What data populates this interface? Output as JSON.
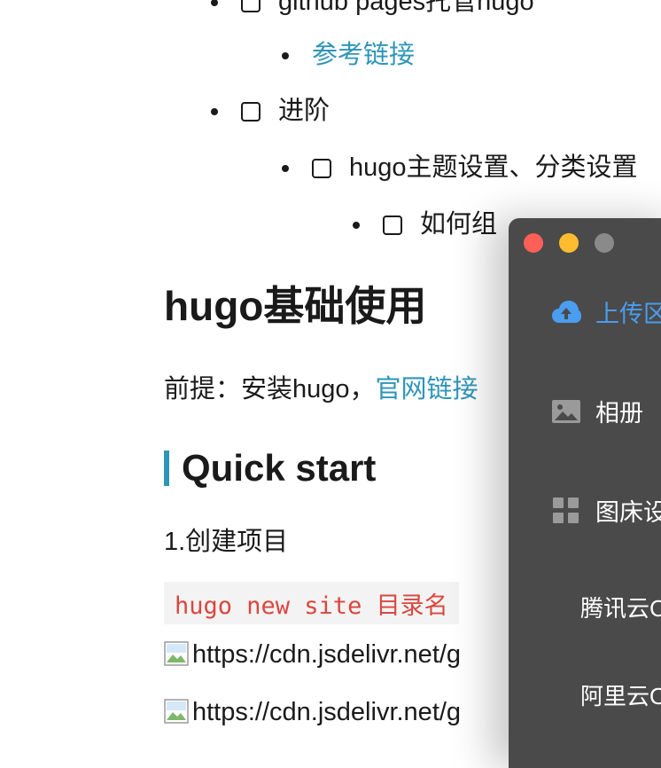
{
  "document": {
    "list": {
      "item_github_pages": "github pages托管hugo",
      "reference_link": "参考链接",
      "advanced": "进阶",
      "hugo_theme_settings": "hugo主题设置、分类设置",
      "how_to_organize": "如何组"
    },
    "heading_basic_usage": "hugo基础使用",
    "prerequisite": {
      "prefix": "前提：安装hugo，",
      "link": "官网链接"
    },
    "heading_quick_start": "Quick start",
    "step1": "1.创建项目",
    "code_snippet": "hugo new site 目录名",
    "image_alts": [
      "https://cdn.jsdelivr.net/g",
      "https://cdn.jsdelivr.net/g"
    ]
  },
  "uploader_window": {
    "sidebar": [
      {
        "label": "上传区",
        "icon": "cloud-upload-icon",
        "active": true
      },
      {
        "label": "相册",
        "icon": "image-icon",
        "active": false
      },
      {
        "label": "图床设置",
        "icon": "grid-icon",
        "active": false
      }
    ],
    "sub_items": [
      "腾讯云COS",
      "阿里云OSS"
    ]
  },
  "colors": {
    "link": "#2f95b8",
    "code_text": "#d9473f",
    "code_bg": "#f3f3f3",
    "window_bg": "#4a4a4a",
    "active_item": "#4a9df0",
    "close": "#fe5f57",
    "minimize": "#febc2e",
    "zoom_disabled": "#8a8a8a"
  }
}
